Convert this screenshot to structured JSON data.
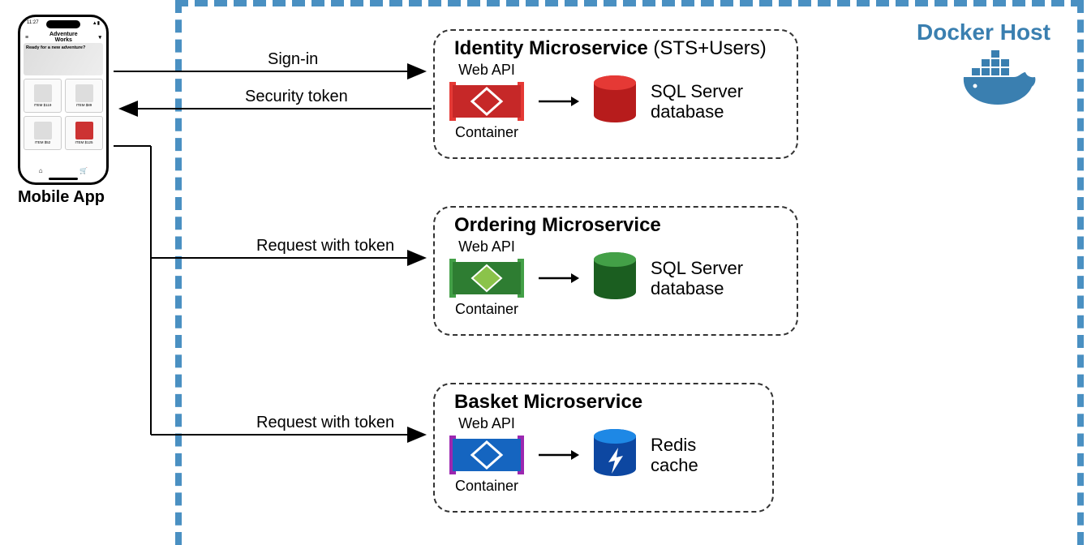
{
  "mobile": {
    "label": "Mobile App",
    "status_time": "11:27",
    "header_title": "Adventure\nWorks"
  },
  "docker": {
    "title": "Docker Host"
  },
  "edges": {
    "signin": "Sign-in",
    "token": "Security token",
    "req_ordering": "Request with token",
    "req_basket": "Request with token"
  },
  "services": {
    "identity": {
      "title_bold": "Identity Microservice",
      "title_suffix": " (STS+Users)",
      "api_label": "Web API",
      "container_label": "Container",
      "storage": "SQL Server database",
      "color": "#c62828",
      "fill": "#e53935"
    },
    "ordering": {
      "title_bold": "Ordering Microservice",
      "title_suffix": "",
      "api_label": "Web API",
      "container_label": "Container",
      "storage": "SQL Server database",
      "color": "#2e7d32",
      "fill": "#8bc34a"
    },
    "basket": {
      "title_bold": "Basket Microservice",
      "title_suffix": "",
      "api_label": "Web API",
      "container_label": "Container",
      "storage": "Redis cache",
      "color": "#1565c0",
      "fill": "#1e88e5"
    }
  }
}
